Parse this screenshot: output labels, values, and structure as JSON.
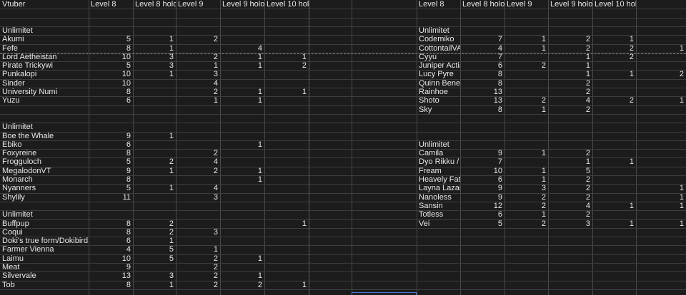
{
  "headers_left": [
    "Vtuber",
    "Level 8",
    "Level 8 holo",
    "Level 9",
    "Level 9 holo",
    "Level 10 holo"
  ],
  "headers_right": [
    "Level 8",
    "Level 8 holo",
    "Level 9",
    "Level 9 holo",
    "Level 10 holo"
  ],
  "left_rows": [
    [],
    [],
    [
      "Unlimitet"
    ],
    [
      "Akumi",
      "5",
      "1",
      "2",
      "",
      ""
    ],
    [
      "Fefe",
      "8",
      "1",
      "",
      "4",
      ""
    ],
    [
      "Lord Aetheistan",
      "10",
      "3",
      "2",
      "1",
      "1"
    ],
    [
      "Pirate Trickywi",
      "5",
      "3",
      "1",
      "1",
      "2"
    ],
    [
      "Punkalopi",
      "10",
      "1",
      "3",
      "",
      ""
    ],
    [
      "Sinder",
      "10",
      "",
      "4",
      "",
      ""
    ],
    [
      "University Numi",
      "8",
      "",
      "2",
      "1",
      "1"
    ],
    [
      "Yuzu",
      "6",
      "",
      "1",
      "1",
      ""
    ],
    [],
    [],
    [
      "Unlimitet"
    ],
    [
      "Boe the Whale",
      "9",
      "1",
      "",
      "",
      ""
    ],
    [
      "Ebiko",
      "6",
      "",
      "",
      "1",
      ""
    ],
    [
      "Foxyreine",
      "8",
      "",
      "2",
      "",
      ""
    ],
    [
      "Frogguloch",
      "5",
      "2",
      "4",
      "",
      ""
    ],
    [
      "MegalodonVT",
      "9",
      "1",
      "2",
      "1",
      ""
    ],
    [
      "Monarch",
      "8",
      "",
      "",
      "1",
      ""
    ],
    [
      "Nyanners",
      "5",
      "1",
      "4",
      "",
      ""
    ],
    [
      "Shylily",
      "11",
      "",
      "3",
      "",
      ""
    ],
    [],
    [
      "Unlimitet"
    ],
    [
      "Buffpup",
      "8",
      "2",
      "",
      "",
      "1"
    ],
    [
      "Coqui",
      "8",
      "2",
      "3",
      "",
      ""
    ],
    [
      "Doki's true form/Dokibird",
      "6",
      "1",
      "",
      "",
      ""
    ],
    [
      "Farmer Vienna",
      "4",
      "5",
      "1",
      "",
      ""
    ],
    [
      "Laimu",
      "10",
      "5",
      "2",
      "1",
      ""
    ],
    [
      "Meat",
      "9",
      "",
      "2",
      "",
      ""
    ],
    [
      "Silvervale",
      "13",
      "3",
      "2",
      "1",
      ""
    ],
    [
      "Tob",
      "8",
      "1",
      "2",
      "2",
      "1"
    ]
  ],
  "right_rows": [
    [],
    [],
    [
      "Unlimitet"
    ],
    [
      "Codemiko",
      "7",
      "1",
      "2",
      "1",
      ""
    ],
    [
      "CottontailVA",
      "4",
      "1",
      "2",
      "2",
      "1"
    ],
    [
      "Cyyu",
      "7",
      "",
      "1",
      "2",
      ""
    ],
    [
      "Juniper Actias",
      "6",
      "2",
      "1",
      "",
      ""
    ],
    [
      "Lucy Pyre",
      "8",
      "",
      "1",
      "1",
      "2"
    ],
    [
      "Quinn Benet",
      "8",
      "",
      "2",
      "",
      ""
    ],
    [
      "Rainhoe",
      "13",
      "",
      "2",
      "",
      ""
    ],
    [
      "Shoto",
      "13",
      "2",
      "4",
      "2",
      "1"
    ],
    [
      "Sky",
      "8",
      "1",
      "2",
      "",
      ""
    ],
    [],
    [],
    [],
    [
      "Unlimitet"
    ],
    [
      "Camila",
      "9",
      "1",
      "2",
      "",
      ""
    ],
    [
      "Dyo Rikku / Dokibird",
      "7",
      "",
      "1",
      "1",
      ""
    ],
    [
      "Fream",
      "10",
      "1",
      "5",
      "",
      ""
    ],
    [
      "Heavely Father",
      "6",
      "1",
      "2",
      "",
      ""
    ],
    [
      "Layna Lazar",
      "9",
      "3",
      "2",
      "",
      "1"
    ],
    [
      "Nanoless",
      "9",
      "2",
      "2",
      "",
      "1"
    ],
    [
      "Sansin",
      "12",
      "2",
      "4",
      "1",
      "1"
    ],
    [
      "Totless",
      "6",
      "1",
      "2",
      "",
      ""
    ],
    [
      "Vei",
      "5",
      "2",
      "3",
      "1",
      "1"
    ]
  ]
}
